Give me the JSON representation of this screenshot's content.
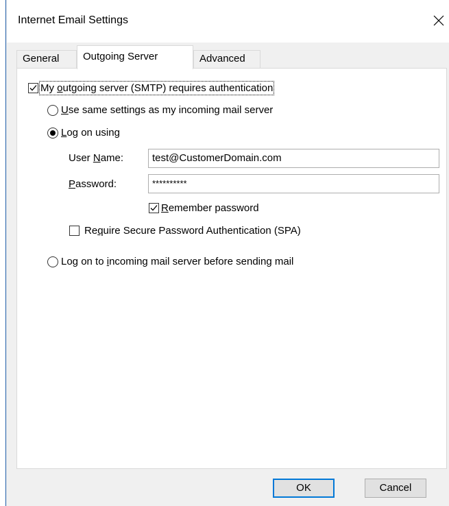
{
  "window": {
    "title": "Internet Email Settings"
  },
  "tabs": [
    {
      "label": "General",
      "active": false
    },
    {
      "label": "Outgoing Server",
      "active": true
    },
    {
      "label": "Advanced",
      "active": false
    }
  ],
  "outgoing": {
    "requires_auth": {
      "label_pre": "My ",
      "label_accel": "o",
      "label_post": "utgoing server (SMTP) requires authentication",
      "checked": true
    },
    "same_settings": {
      "label_accel": "U",
      "label_post": "se same settings as my incoming mail server",
      "selected": false
    },
    "log_on_using": {
      "label_accel": "L",
      "label_post": "og on using",
      "selected": true
    },
    "username": {
      "label_pre": "User ",
      "label_accel": "N",
      "label_post": "ame:",
      "value": "test@CustomerDomain.com"
    },
    "password": {
      "label_accel": "P",
      "label_post": "assword:",
      "value": "**********"
    },
    "remember": {
      "label_accel": "R",
      "label_post": "emember password",
      "checked": true
    },
    "spa": {
      "label_pre": "Re",
      "label_accel": "q",
      "label_post": "uire Secure Password Authentication (SPA)",
      "checked": false
    },
    "log_on_incoming": {
      "label_pre": "Log on to ",
      "label_accel": "i",
      "label_post": "ncoming mail server before sending mail",
      "selected": false
    }
  },
  "buttons": {
    "ok": "OK",
    "cancel": "Cancel"
  },
  "colors": {
    "accent": "#0078d7",
    "frame": "#1c5aa6"
  }
}
